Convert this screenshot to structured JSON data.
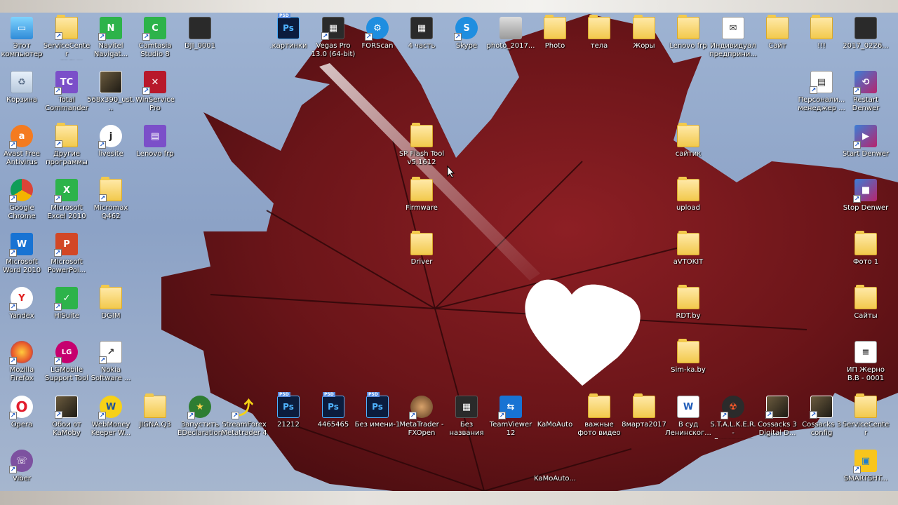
{
  "desktop": {
    "icons": [
      {
        "label": "Этот\nкомпьютер",
        "icon": "computer-icon",
        "kind": "pc",
        "glyph": "▭",
        "shortcut": false,
        "name": "this-computer"
      },
      {
        "label": "ServiceCenter\n— ярлык",
        "icon": "folder-shortcut-icon",
        "kind": "folder",
        "glyph": "",
        "shortcut": true,
        "name": "servicecenter-shortcut"
      },
      {
        "label": "Navitel\nNavigat...",
        "icon": "navitel-icon",
        "kind": "green",
        "glyph": "N",
        "shortcut": true,
        "name": "navitel"
      },
      {
        "label": "Camtasia\nStudio 8",
        "icon": "camtasia-icon",
        "kind": "green",
        "glyph": "C",
        "shortcut": true,
        "name": "camtasia"
      },
      {
        "label": "DJI_0001",
        "icon": "image-file-icon",
        "kind": "dark",
        "glyph": "",
        "shortcut": false,
        "name": "dji-0001"
      },
      {
        "label": "Корзина",
        "icon": "recycle-bin-icon",
        "kind": "trash",
        "glyph": "♻",
        "shortcut": false,
        "name": "recycle-bin"
      },
      {
        "label": "Total\nCommander",
        "icon": "total-commander-icon",
        "kind": "purple",
        "glyph": "TC",
        "shortcut": true,
        "name": "total-commander"
      },
      {
        "label": "568x390_ust...",
        "icon": "image-file-icon",
        "kind": "photo",
        "glyph": "",
        "shortcut": false,
        "name": "image-568x390"
      },
      {
        "label": "WinService\nPro",
        "icon": "tools-icon",
        "kind": "red",
        "glyph": "✕",
        "shortcut": true,
        "name": "winservice-pro"
      },
      {
        "label": "Avast Free\nAntivirus",
        "icon": "avast-icon",
        "kind": "round-orange",
        "glyph": "a",
        "shortcut": true,
        "name": "avast"
      },
      {
        "label": "Другие\nпрограммы",
        "icon": "folder-shortcut-icon",
        "kind": "folder",
        "glyph": "",
        "shortcut": true,
        "name": "other-programs"
      },
      {
        "label": "livesite",
        "icon": "livesite-icon",
        "kind": "round-white",
        "glyph": "j",
        "shortcut": true,
        "name": "livesite"
      },
      {
        "label": "Lenovo frp",
        "icon": "winrar-icon",
        "kind": "purple",
        "glyph": "▤",
        "shortcut": false,
        "name": "lenovo-frp-archive"
      },
      {
        "label": "SP Flash Tool\nv5.1612",
        "icon": "folder-icon",
        "kind": "folder",
        "glyph": "",
        "shortcut": false,
        "name": "sp-flash-tool"
      },
      {
        "label": "Firmware",
        "icon": "folder-icon",
        "kind": "folder",
        "glyph": "",
        "shortcut": false,
        "name": "firmware"
      },
      {
        "label": "Driver",
        "icon": "folder-icon",
        "kind": "folder",
        "glyph": "",
        "shortcut": false,
        "name": "driver"
      },
      {
        "label": "Google\nChrome",
        "icon": "chrome-icon",
        "kind": "round-chrome",
        "glyph": "",
        "shortcut": true,
        "name": "chrome"
      },
      {
        "label": "Microsoft\nExcel 2010",
        "icon": "excel-icon",
        "kind": "green",
        "glyph": "X",
        "shortcut": true,
        "name": "excel"
      },
      {
        "label": "Micromax\nQ462",
        "icon": "folder-icon",
        "kind": "folder",
        "glyph": "",
        "shortcut": true,
        "name": "micromax-q462"
      },
      {
        "label": "Microsoft\nWord 2010",
        "icon": "word-icon",
        "kind": "blue",
        "glyph": "W",
        "shortcut": true,
        "name": "word"
      },
      {
        "label": "Microsoft\nPowerPoi...",
        "icon": "powerpoint-icon",
        "kind": "orange",
        "glyph": "P",
        "shortcut": true,
        "name": "powerpoint"
      },
      {
        "label": "Yandex",
        "icon": "yandex-icon",
        "kind": "round-white-red",
        "glyph": "Y",
        "shortcut": true,
        "name": "yandex"
      },
      {
        "label": "HiSuite",
        "icon": "hisuite-icon",
        "kind": "green",
        "glyph": "✓",
        "shortcut": true,
        "name": "hisuite"
      },
      {
        "label": "DGIM",
        "icon": "folder-icon",
        "kind": "folder",
        "glyph": "",
        "shortcut": false,
        "name": "dgim"
      },
      {
        "label": "Mozilla\nFirefox",
        "icon": "firefox-icon",
        "kind": "round-firefox",
        "glyph": "",
        "shortcut": true,
        "name": "firefox"
      },
      {
        "label": "LGMobile\nSupport Tool",
        "icon": "lg-icon",
        "kind": "round-lg",
        "glyph": "LG",
        "shortcut": true,
        "name": "lg-mobile-support"
      },
      {
        "label": "Nokia\nSoftware ...",
        "icon": "nokia-icon",
        "kind": "doc",
        "glyph": "↗",
        "shortcut": true,
        "name": "nokia-software"
      },
      {
        "label": "Opera",
        "icon": "opera-icon",
        "kind": "round-opera",
        "glyph": "O",
        "shortcut": true,
        "name": "opera"
      },
      {
        "label": "Обои от\nKaMoby",
        "icon": "wallpaper-shortcut-icon",
        "kind": "photo",
        "glyph": "",
        "shortcut": true,
        "name": "wallpapers-kamoby"
      },
      {
        "label": "WebMoney\nKeeper W...",
        "icon": "webmoney-icon",
        "kind": "round-yellow",
        "glyph": "W",
        "shortcut": true,
        "name": "webmoney"
      },
      {
        "label": "JIGNA.Q3",
        "icon": "folder-icon",
        "kind": "folder",
        "glyph": "",
        "shortcut": false,
        "name": "jigna-q3"
      },
      {
        "label": "Запустить\nEDeclaration",
        "icon": "edeclaration-icon",
        "kind": "round-green",
        "glyph": "★",
        "shortcut": true,
        "name": "edeclaration"
      },
      {
        "label": "StreamForex\nMetatrader 4",
        "icon": "metatrader-icon",
        "kind": "yellow-arrow",
        "glyph": "⤴",
        "shortcut": true,
        "name": "streamforex"
      },
      {
        "label": "21212",
        "icon": "photoshop-file-icon",
        "kind": "ps",
        "glyph": "Ps",
        "shortcut": false,
        "name": "psd-21212"
      },
      {
        "label": "4465465",
        "icon": "photoshop-file-icon",
        "kind": "ps",
        "glyph": "Ps",
        "shortcut": false,
        "name": "psd-4465465"
      },
      {
        "label": "Без имени-1",
        "icon": "photoshop-file-icon",
        "kind": "ps",
        "glyph": "Ps",
        "shortcut": false,
        "name": "psd-untitled-1"
      },
      {
        "label": "MetaTrader -\nFXOpen",
        "icon": "metatrader-icon",
        "kind": "round-photo",
        "glyph": "",
        "shortcut": true,
        "name": "metatrader-fxopen"
      },
      {
        "label": "Без\nназвания",
        "icon": "video-file-icon",
        "kind": "dark",
        "glyph": "▦",
        "shortcut": false,
        "name": "untitled-video"
      },
      {
        "label": "TeamViewer\n12",
        "icon": "teamviewer-icon",
        "kind": "blue",
        "glyph": "⇆",
        "shortcut": true,
        "name": "teamviewer"
      },
      {
        "label": "KaMoAuto",
        "icon": "folder-icon",
        "kind": "none",
        "glyph": "",
        "shortcut": false,
        "name": "kamoauto"
      },
      {
        "label": "важные\nфото видео",
        "icon": "folder-icon",
        "kind": "folder",
        "glyph": "",
        "shortcut": false,
        "name": "important-photo-video"
      },
      {
        "label": "8марта2017",
        "icon": "folder-icon",
        "kind": "folder",
        "glyph": "",
        "shortcut": false,
        "name": "march-8-2017"
      },
      {
        "label": "В суд\nЛенинског...",
        "icon": "word-doc-icon",
        "kind": "doc-word",
        "glyph": "W",
        "shortcut": false,
        "name": "court-doc"
      },
      {
        "label": "S.T.A.L.K.E.R. -\nДиверсант",
        "icon": "stalker-icon",
        "kind": "round-dark",
        "glyph": "☢",
        "shortcut": true,
        "name": "stalker"
      },
      {
        "label": "Cossacks 3\nDigital D...",
        "icon": "cossacks-icon",
        "kind": "photo",
        "glyph": "",
        "shortcut": true,
        "name": "cossacks-digital"
      },
      {
        "label": "Cossacks 3\nconfig",
        "icon": "cossacks-icon",
        "kind": "photo",
        "glyph": "",
        "shortcut": true,
        "name": "cossacks-config"
      },
      {
        "label": "ServiceCenter",
        "icon": "folder-icon",
        "kind": "folder",
        "glyph": "",
        "shortcut": false,
        "name": "servicecenter"
      },
      {
        "label": "Viber",
        "icon": "viber-icon",
        "kind": "round-viber",
        "glyph": "☏",
        "shortcut": true,
        "name": "viber"
      },
      {
        "label": "KaMoAuto...",
        "icon": "file-icon",
        "kind": "none",
        "glyph": "",
        "shortcut": false,
        "name": "kamoauto-file"
      },
      {
        "label": "SMARTSHT...",
        "icon": "smartsht-icon",
        "kind": "yellow-box",
        "glyph": "▣",
        "shortcut": true,
        "name": "smartsht"
      },
      {
        "label": ".картинки",
        "icon": "photoshop-file-icon",
        "kind": "ps",
        "glyph": "Ps",
        "shortcut": false,
        "name": "psd-images"
      },
      {
        "label": "Vegas Pro\n13.0 (64-bit)",
        "icon": "vegas-icon",
        "kind": "dark",
        "glyph": "▦",
        "shortcut": true,
        "name": "vegas-pro"
      },
      {
        "label": "FORScan",
        "icon": "forscan-icon",
        "kind": "round-blue",
        "glyph": "⚙",
        "shortcut": true,
        "name": "forscan"
      },
      {
        "label": "4 часть",
        "icon": "video-file-icon",
        "kind": "dark",
        "glyph": "▦",
        "shortcut": false,
        "name": "part-4"
      },
      {
        "label": "Skype",
        "icon": "skype-icon",
        "kind": "round-blue",
        "glyph": "S",
        "shortcut": true,
        "name": "skype"
      },
      {
        "label": "photo_2017...",
        "icon": "image-file-icon",
        "kind": "gray",
        "glyph": "",
        "shortcut": false,
        "name": "photo-2017"
      },
      {
        "label": "Photo",
        "icon": "folder-icon",
        "kind": "folder",
        "glyph": "",
        "shortcut": false,
        "name": "photo-folder"
      },
      {
        "label": "тела",
        "icon": "folder-icon",
        "kind": "folder",
        "glyph": "",
        "shortcut": false,
        "name": "tela-folder"
      },
      {
        "label": "Жоры",
        "icon": "folder-icon",
        "kind": "folder",
        "glyph": "",
        "shortcut": false,
        "name": "zhory-folder"
      },
      {
        "label": "Lenovo frp",
        "icon": "folder-icon",
        "kind": "folder",
        "glyph": "",
        "shortcut": false,
        "name": "lenovo-frp-folder"
      },
      {
        "label": "Индивидуал\nпредприни...",
        "icon": "certificate-icon",
        "kind": "doc",
        "glyph": "✉",
        "shortcut": false,
        "name": "individual-entrepreneur"
      },
      {
        "label": "Сайт",
        "icon": "folder-icon",
        "kind": "folder",
        "glyph": "",
        "shortcut": false,
        "name": "site-folder"
      },
      {
        "label": "!!!",
        "icon": "folder-icon",
        "kind": "folder",
        "glyph": "",
        "shortcut": false,
        "name": "exclaim-folder"
      },
      {
        "label": "2017_0226...",
        "icon": "image-file-icon",
        "kind": "dark",
        "glyph": "",
        "shortcut": false,
        "name": "image-2017-0226"
      },
      {
        "label": "Персонали...\nменеджер ...",
        "icon": "app-icon",
        "kind": "doc",
        "glyph": "▤",
        "shortcut": true,
        "name": "personal-manager"
      },
      {
        "label": "Restart\nDenwer",
        "icon": "denwer-icon",
        "kind": "denwer",
        "glyph": "⟲",
        "shortcut": true,
        "name": "restart-denwer"
      },
      {
        "label": "Start Denwer",
        "icon": "denwer-icon",
        "kind": "denwer",
        "glyph": "▶",
        "shortcut": true,
        "name": "start-denwer"
      },
      {
        "label": "Stop Denwer",
        "icon": "denwer-icon",
        "kind": "denwer",
        "glyph": "■",
        "shortcut": true,
        "name": "stop-denwer"
      },
      {
        "label": "сайтик",
        "icon": "folder-icon",
        "kind": "folder",
        "glyph": "",
        "shortcut": false,
        "name": "saitik-folder"
      },
      {
        "label": "upload",
        "icon": "folder-icon",
        "kind": "folder",
        "glyph": "",
        "shortcut": false,
        "name": "upload-folder"
      },
      {
        "label": "aVTOKIT",
        "icon": "folder-icon",
        "kind": "folder",
        "glyph": "",
        "shortcut": false,
        "name": "avtokit-folder"
      },
      {
        "label": "RDT.by",
        "icon": "folder-icon",
        "kind": "folder",
        "glyph": "",
        "shortcut": false,
        "name": "rdt-folder"
      },
      {
        "label": "Sim-ka.by",
        "icon": "folder-icon",
        "kind": "folder",
        "glyph": "",
        "shortcut": false,
        "name": "simka-folder"
      },
      {
        "label": "Фото 1",
        "icon": "folder-icon",
        "kind": "folder",
        "glyph": "",
        "shortcut": false,
        "name": "photo-1-folder"
      },
      {
        "label": "Сайты",
        "icon": "folder-icon",
        "kind": "folder",
        "glyph": "",
        "shortcut": false,
        "name": "sites-folder"
      },
      {
        "label": "ИП Жерно\nB.B - 0001",
        "icon": "document-icon",
        "kind": "doc",
        "glyph": "≡",
        "shortcut": false,
        "name": "ip-document"
      }
    ]
  }
}
